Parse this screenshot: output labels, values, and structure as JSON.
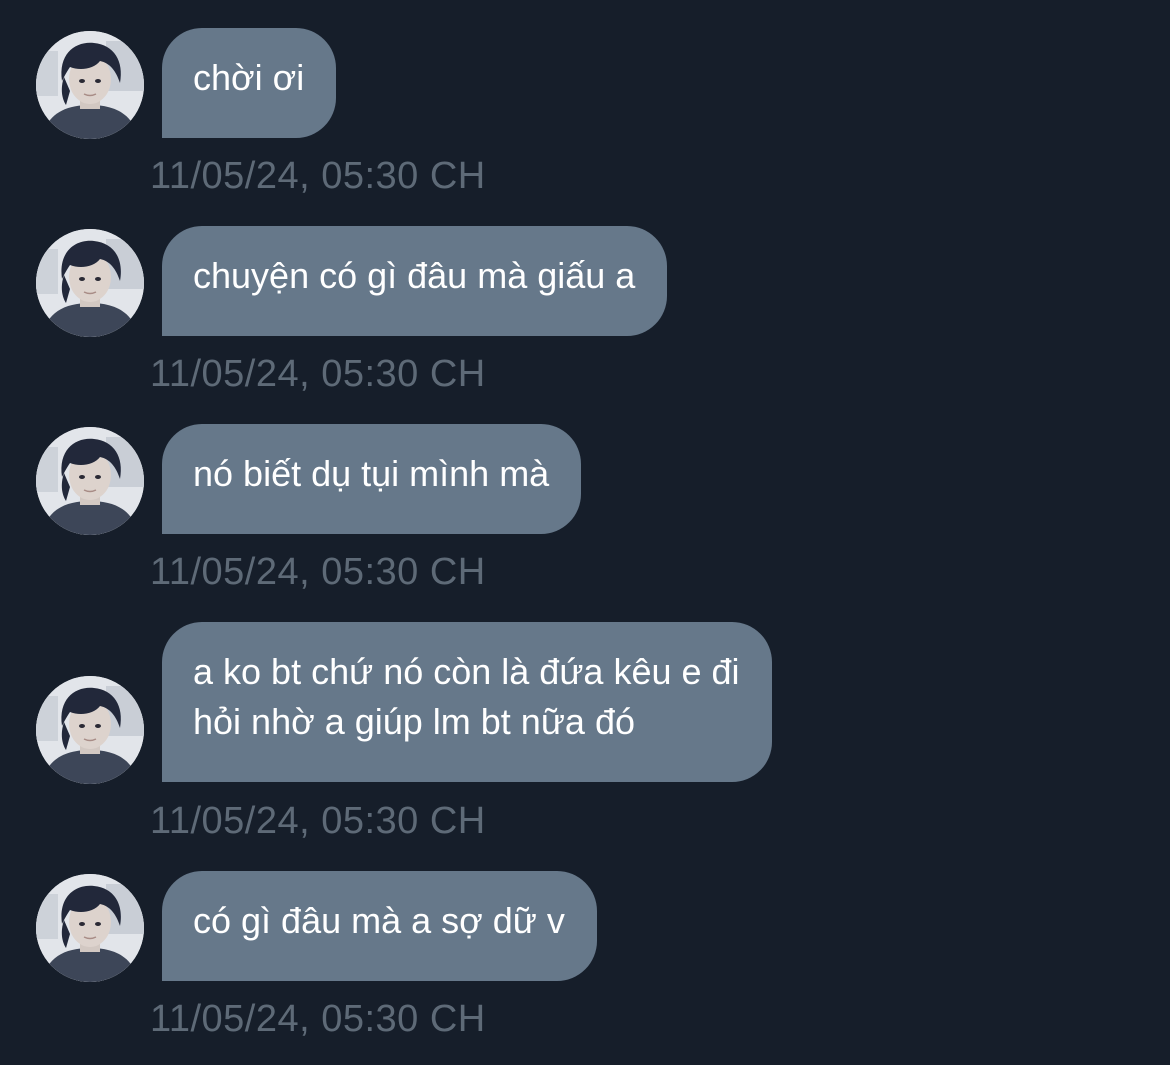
{
  "conversation": {
    "messages": [
      {
        "text": "chời ơi",
        "time": "11/05/24, 05:30 CH",
        "avatar_icon": "user-avatar-icon"
      },
      {
        "text": "chuyện có gì đâu mà giấu a",
        "time": "11/05/24, 05:30 CH",
        "avatar_icon": "user-avatar-icon"
      },
      {
        "text": "nó biết dụ tụi mình mà",
        "time": "11/05/24, 05:30 CH",
        "avatar_icon": "user-avatar-icon"
      },
      {
        "text": "a ko bt chứ nó còn là đứa kêu e đi\nhỏi nhờ a giúp lm bt nữa đó",
        "time": "11/05/24, 05:30 CH",
        "avatar_icon": "user-avatar-icon"
      },
      {
        "text": "có gì đâu mà a sợ dữ v",
        "time": "11/05/24, 05:30 CH",
        "avatar_icon": "user-avatar-icon"
      }
    ]
  },
  "theme": {
    "background": "#161e2a",
    "bubble": "#66788a",
    "bubble_text": "#ffffff",
    "timestamp": "#5e6a77"
  }
}
